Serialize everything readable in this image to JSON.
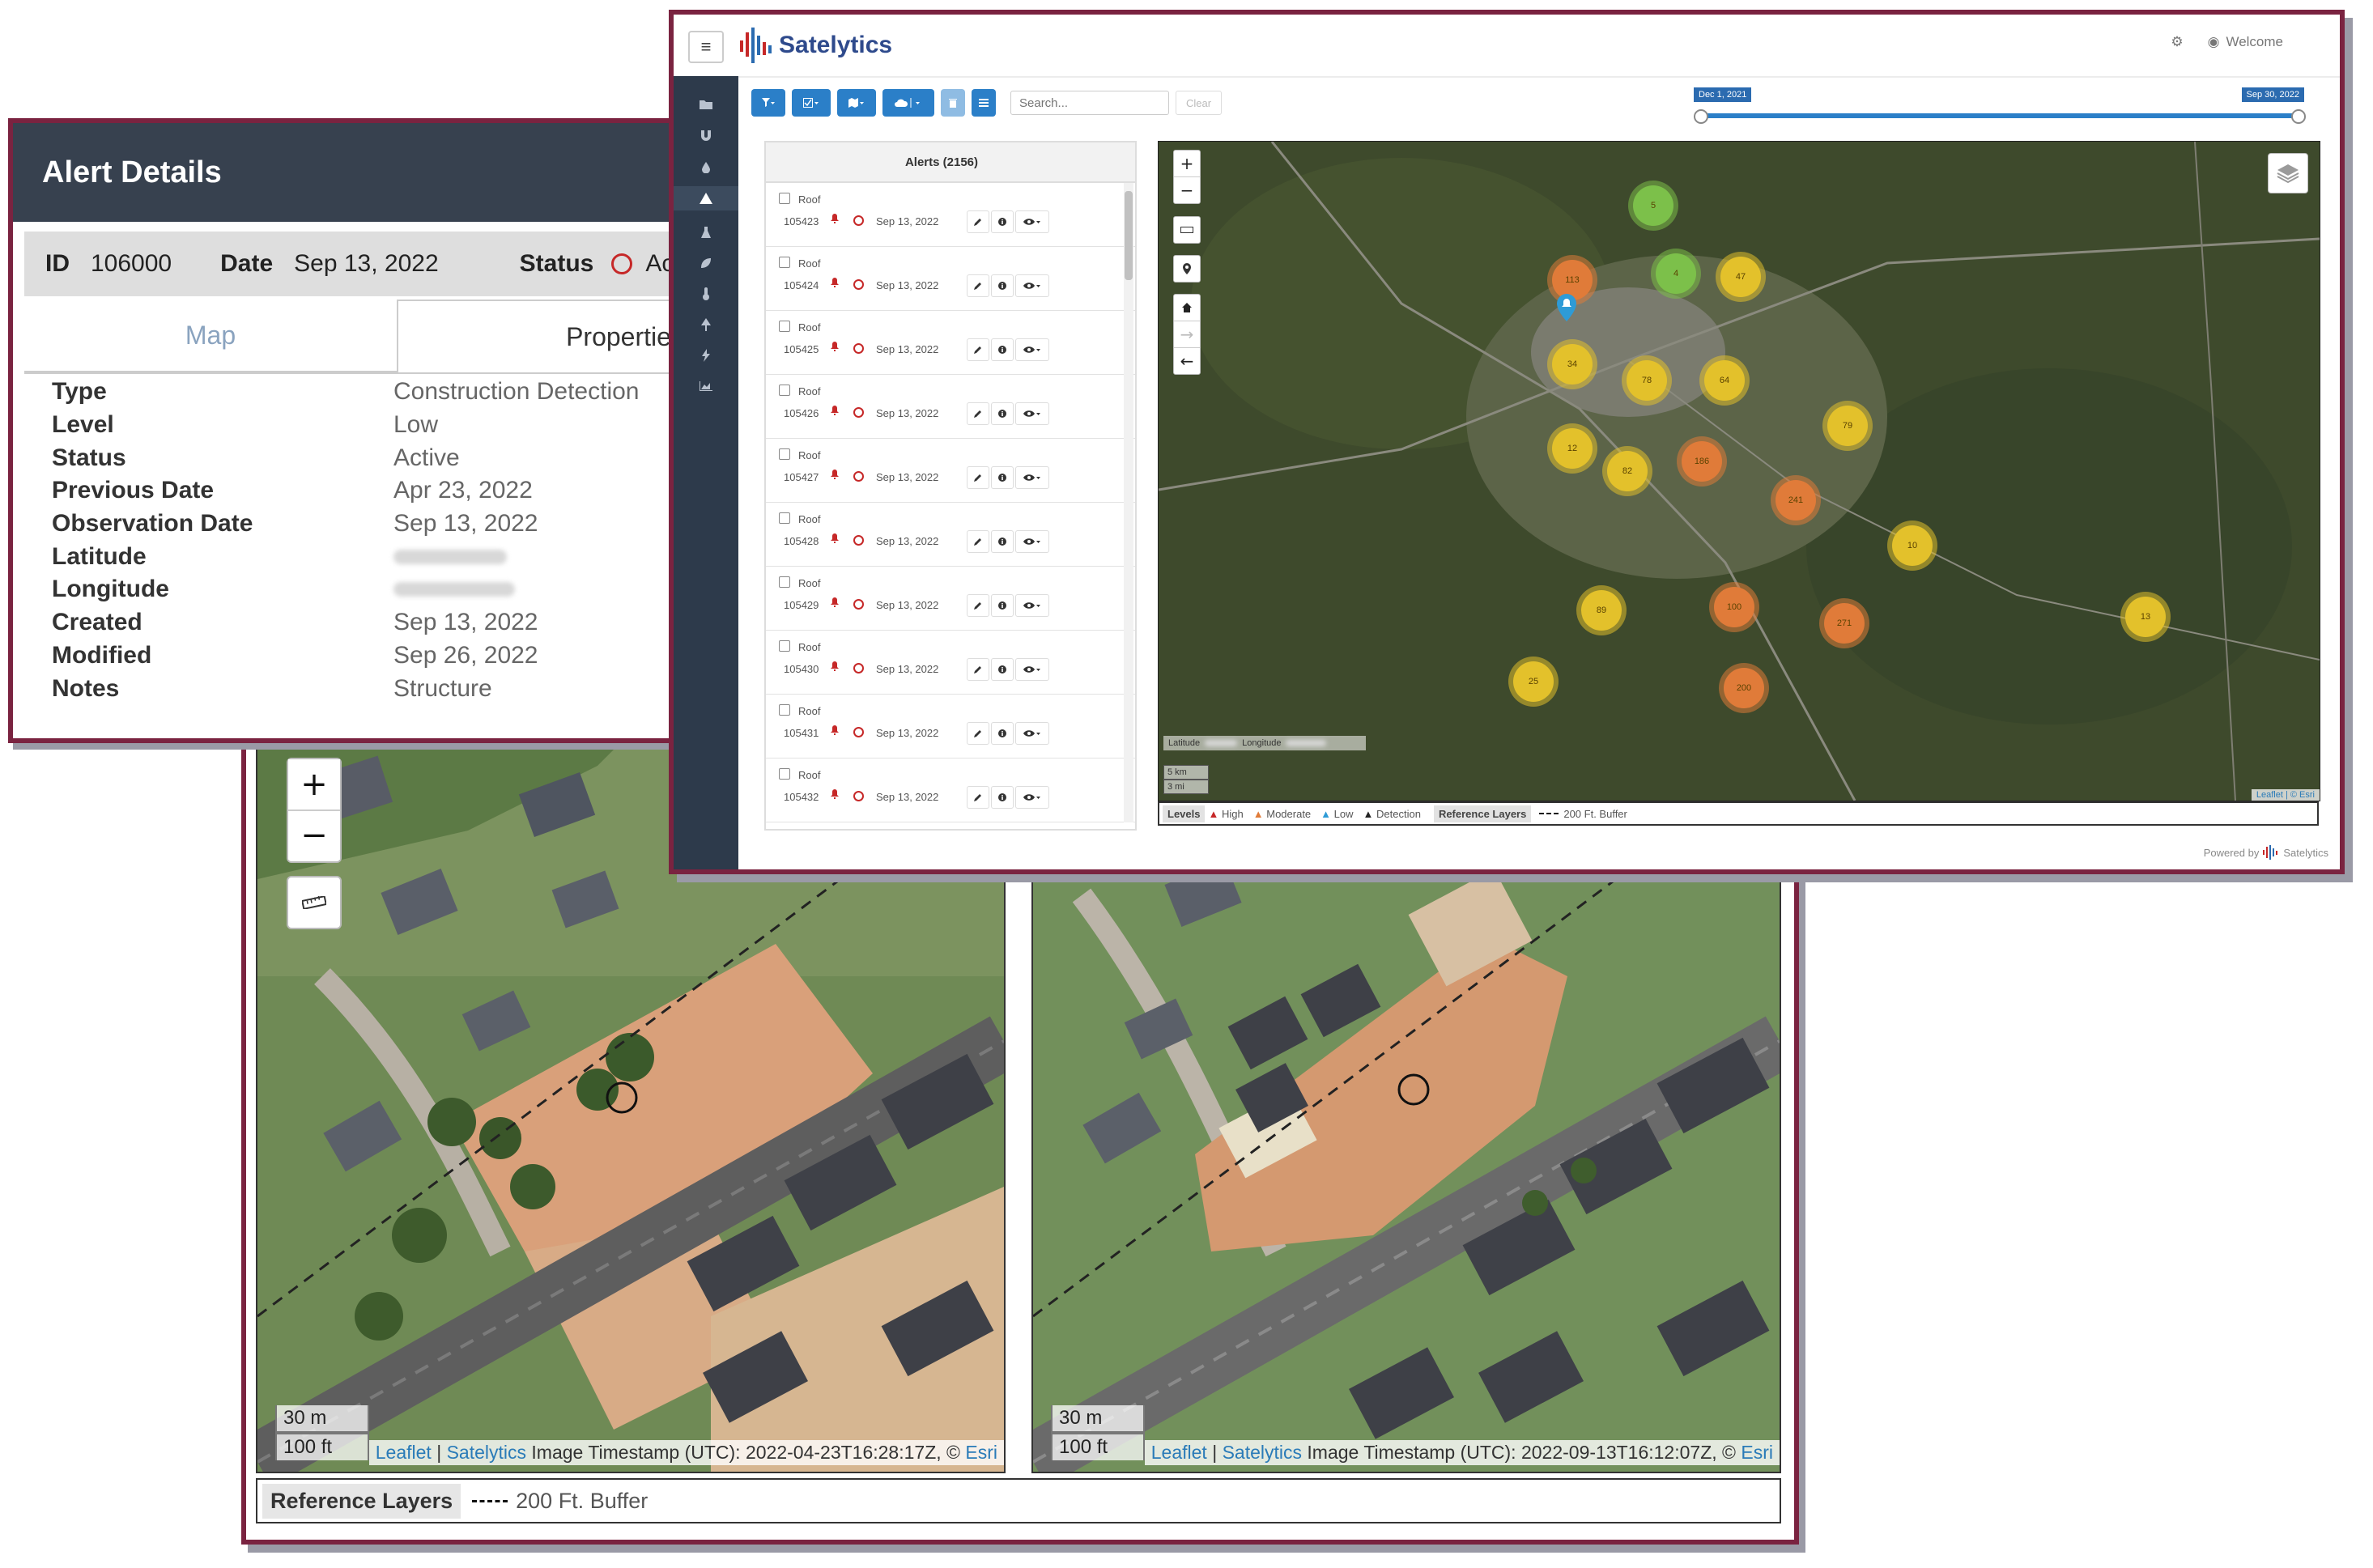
{
  "compare": {
    "before": {
      "scale_m": "30 m",
      "scale_ft": "100 ft",
      "attrib_leaflet": "Leaflet",
      "attrib_sep": " | ",
      "attrib_satelytics": "Satelytics",
      "attrib_text": " Image Timestamp (UTC): 2022-04-23T16:28:17Z, © ",
      "attrib_esri": "Esri"
    },
    "after": {
      "scale_m": "30 m",
      "scale_ft": "100 ft",
      "attrib_leaflet": "Leaflet",
      "attrib_sep": " | ",
      "attrib_satelytics": "Satelytics",
      "attrib_text": " Image Timestamp (UTC): 2022-09-13T16:12:07Z, © ",
      "attrib_esri": "Esri"
    },
    "zoom_in": "+",
    "zoom_out": "−",
    "reference_layers_label": "Reference Layers",
    "buffer_label": "200 Ft. Buffer"
  },
  "details": {
    "title": "Alert Details",
    "id_label": "ID",
    "id_value": "106000",
    "date_label": "Date",
    "date_value": "Sep 13, 2022",
    "status_label": "Status",
    "status_value": "Ac",
    "tabs": {
      "map": "Map",
      "properties": "Properties"
    },
    "properties": [
      {
        "key": "Type",
        "value": "Construction Detection"
      },
      {
        "key": "Level",
        "value": "Low"
      },
      {
        "key": "Status",
        "value": "Active"
      },
      {
        "key": "Previous Date",
        "value": "Apr 23, 2022"
      },
      {
        "key": "Observation Date",
        "value": "Sep 13, 2022"
      },
      {
        "key": "Latitude",
        "value": ""
      },
      {
        "key": "Longitude",
        "value": ""
      },
      {
        "key": "Created",
        "value": "Sep 13, 2022"
      },
      {
        "key": "Modified",
        "value": "Sep 26, 2022"
      },
      {
        "key": "Notes",
        "value": "Structure"
      }
    ]
  },
  "dashboard": {
    "brand": "Satelytics",
    "welcome": "Welcome",
    "search_placeholder": "Search...",
    "clear_label": "Clear",
    "timeline": {
      "start": "Dec 1, 2021",
      "end": "Sep 30, 2022"
    },
    "alerts_title": "Alerts (2156)",
    "alerts": [
      {
        "type": "Roof",
        "id": "105423",
        "date": "Sep 13, 2022"
      },
      {
        "type": "Roof",
        "id": "105424",
        "date": "Sep 13, 2022"
      },
      {
        "type": "Roof",
        "id": "105425",
        "date": "Sep 13, 2022"
      },
      {
        "type": "Roof",
        "id": "105426",
        "date": "Sep 13, 2022"
      },
      {
        "type": "Roof",
        "id": "105427",
        "date": "Sep 13, 2022"
      },
      {
        "type": "Roof",
        "id": "105428",
        "date": "Sep 13, 2022"
      },
      {
        "type": "Roof",
        "id": "105429",
        "date": "Sep 13, 2022"
      },
      {
        "type": "Roof",
        "id": "105430",
        "date": "Sep 13, 2022"
      },
      {
        "type": "Roof",
        "id": "105431",
        "date": "Sep 13, 2022"
      },
      {
        "type": "Roof",
        "id": "105432",
        "date": "Sep 13, 2022"
      }
    ],
    "clusters": [
      {
        "label": "5",
        "color": "#7cc04a"
      },
      {
        "label": "113",
        "color": "#e07b39"
      },
      {
        "label": "4",
        "color": "#7cc04a"
      },
      {
        "label": "47",
        "color": "#e3c12b"
      },
      {
        "label": "34",
        "color": "#e3c12b"
      },
      {
        "label": "78",
        "color": "#e3c12b"
      },
      {
        "label": "64",
        "color": "#e3c12b"
      },
      {
        "label": "12",
        "color": "#e3c12b"
      },
      {
        "label": "82",
        "color": "#e3c12b"
      },
      {
        "label": "186",
        "color": "#e07b39"
      },
      {
        "label": "79",
        "color": "#e3c12b"
      },
      {
        "label": "241",
        "color": "#e07b39"
      },
      {
        "label": "10",
        "color": "#e3c12b"
      },
      {
        "label": "89",
        "color": "#e3c12b"
      },
      {
        "label": "100",
        "color": "#e07b39"
      },
      {
        "label": "271",
        "color": "#e07b39"
      },
      {
        "label": "13",
        "color": "#e3c12b"
      },
      {
        "label": "25",
        "color": "#e3c12b"
      },
      {
        "label": "200",
        "color": "#e07b39"
      }
    ],
    "coord_lat_label": "Latitude",
    "coord_lng_label": "Longitude",
    "ov_scale_km": "5 km",
    "ov_scale_mi": "3 mi",
    "ov_attrib": "Leaflet | © Esri",
    "legend": {
      "levels_label": "Levels",
      "high": "High",
      "moderate": "Moderate",
      "low": "Low",
      "detection": "Detection",
      "reference_layers_label": "Reference Layers",
      "buffer": "200 Ft. Buffer"
    },
    "powered_by": "Powered by",
    "powered_brand": "Satelytics"
  },
  "colors": {
    "frame": "#7a2340",
    "header_dark": "#37414f",
    "sidebar": "#2d3a4b",
    "accent": "#2b7fc8",
    "alert_red": "#c62828",
    "moderate_orange": "#e07b39",
    "low_yellow": "#e3c12b",
    "green": "#7cc04a"
  }
}
